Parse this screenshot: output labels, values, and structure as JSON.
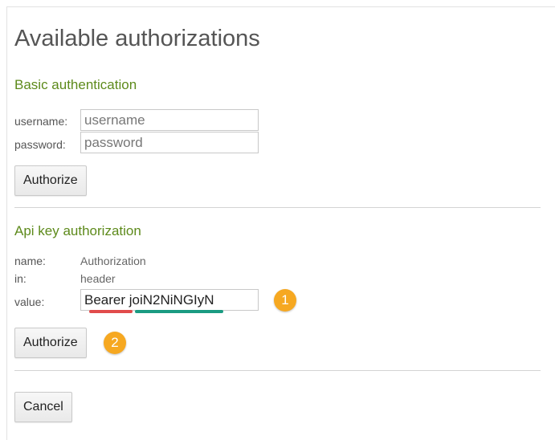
{
  "dialog": {
    "title": "Available authorizations"
  },
  "basic_auth": {
    "section_title": "Basic authentication",
    "username_label": "username:",
    "username_placeholder": "username",
    "password_label": "password:",
    "password_placeholder": "password",
    "authorize_label": "Authorize"
  },
  "api_key": {
    "section_title": "Api key authorization",
    "name_label": "name:",
    "name_value": "Authorization",
    "in_label": "in:",
    "in_value": "header",
    "value_label": "value:",
    "value_input": "Bearer joiN2NiNGIyN",
    "authorize_label": "Authorize"
  },
  "annotations": {
    "badge_1": "1",
    "badge_2": "2",
    "badge_color": "#f6a821",
    "scheme_underline_color": "#e14b4b",
    "token_underline_color": "#1a9b82"
  },
  "footer": {
    "cancel_label": "Cancel"
  },
  "colors": {
    "section_title": "#5d8a1b",
    "title": "#555555"
  }
}
